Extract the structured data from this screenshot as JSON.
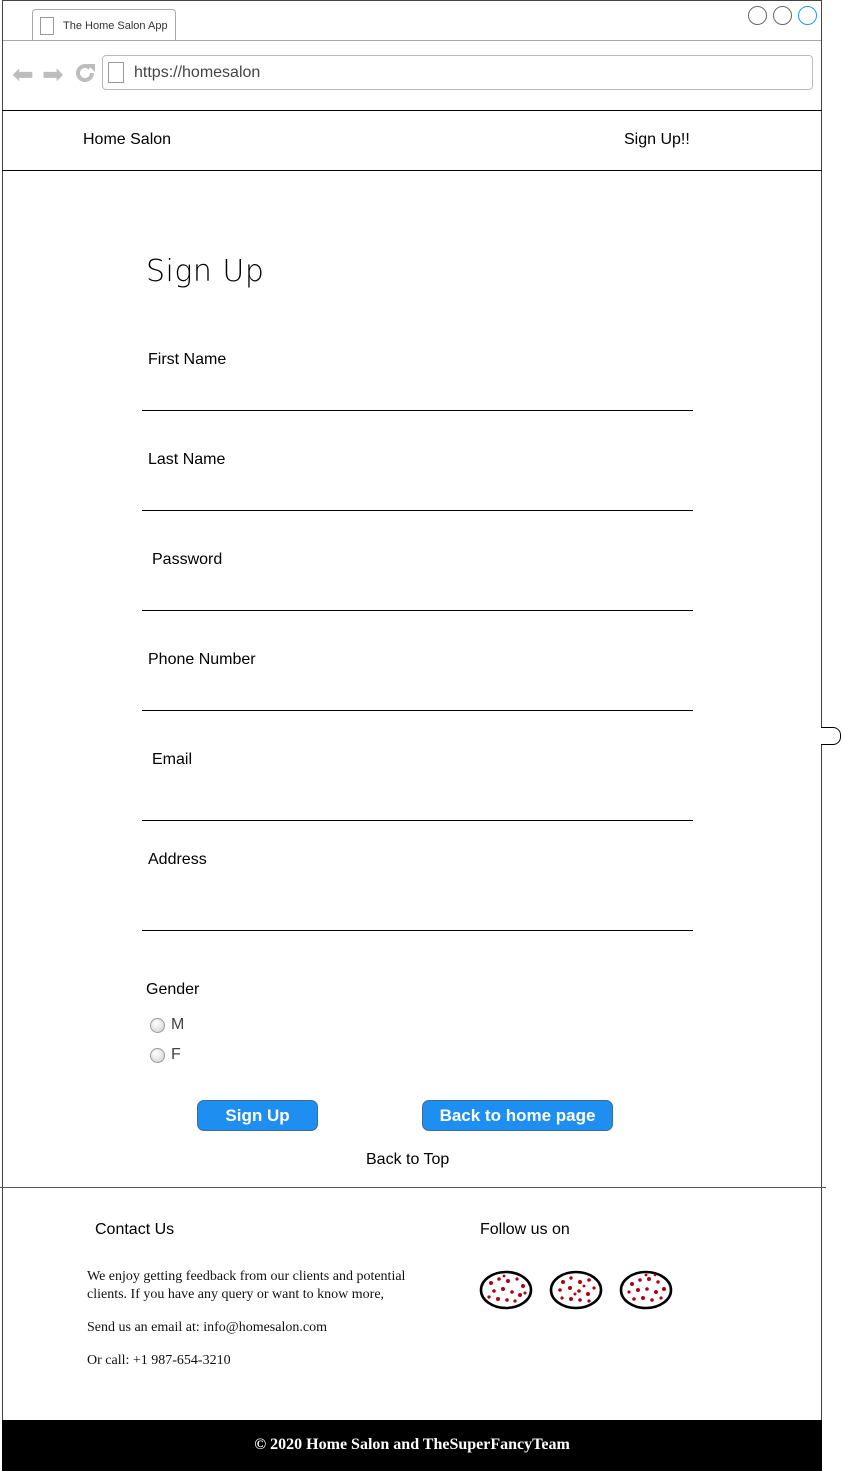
{
  "browser": {
    "tab_title": "The Home Salon App",
    "url": "https://homesalon"
  },
  "nav": {
    "brand": "Home Salon",
    "signup_link": "Sign Up!!"
  },
  "form": {
    "title": "Sign Up",
    "fields": {
      "first_name": "First Name",
      "last_name": "Last Name",
      "password": "Password",
      "phone": "Phone Number",
      "email": "Email",
      "address": "Address"
    },
    "gender": {
      "label": "Gender",
      "options": [
        "M",
        "F"
      ]
    },
    "signup_button": "Sign Up",
    "back_home_button": "Back to home page",
    "back_to_top": "Back to Top"
  },
  "footer": {
    "contact_heading": "Contact Us",
    "follow_heading": "Follow us on",
    "contact_text": "We enjoy getting feedback from our clients and potential clients. If you have any query or want to know more,",
    "email_line": "Send us an email at: info@homesalon.com",
    "phone_line": "Or call: +1 987-654-3210",
    "copyright": "© 2020 Home Salon and TheSuperFancyTeam"
  },
  "icons": {
    "social": [
      "social-icon",
      "social-icon",
      "social-icon"
    ]
  },
  "colors": {
    "button": "#1e8ef0",
    "footer_bar": "#000000",
    "social_dots": "#b00010"
  }
}
